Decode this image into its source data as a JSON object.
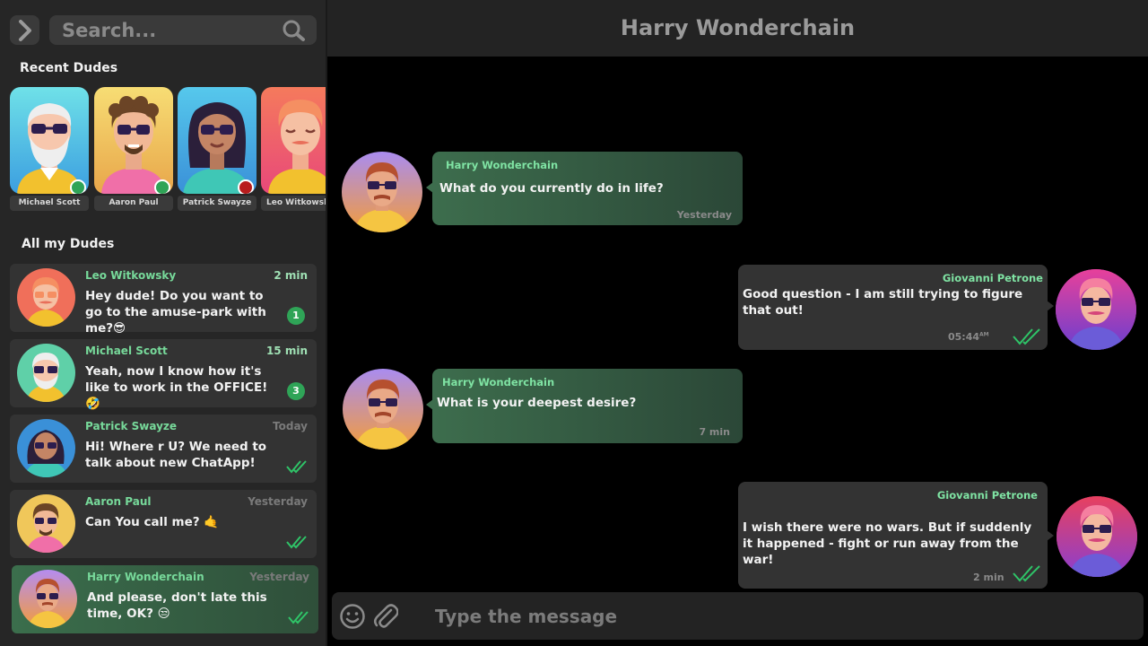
{
  "sidebar": {
    "search_placeholder": "Search...",
    "recent_title": "Recent Dudes",
    "all_title": "All my Dudes",
    "recent": [
      {
        "name": "Michael Scott",
        "status": "online",
        "status_color": "#2fa457",
        "bg": "#5fd0d8"
      },
      {
        "name": "Aaron Paul",
        "status": "online",
        "status_color": "#2fa457",
        "bg": "#f0c75a"
      },
      {
        "name": "Patrick Swayze",
        "status": "busy",
        "status_color": "#b81d1d",
        "bg": "#4bb8e8"
      },
      {
        "name": "Leo Witkowsky",
        "status": "unknown",
        "status_color": "",
        "bg": "#f06f5a"
      }
    ],
    "chats": [
      {
        "name": "Leo Witkowsky",
        "time": "2 min",
        "message": "Hey dude! Do you want to go to the amuse-park with me?😎",
        "badge": "1",
        "indicator": "badge"
      },
      {
        "name": "Michael Scott",
        "time": "15 min",
        "message": "Yeah, now I know how it's like to work in the OFFICE!🤣",
        "badge": "3",
        "indicator": "badge"
      },
      {
        "name": "Patrick Swayze",
        "time": "Today",
        "message": "Hi! Where r U? We need to talk about new ChatApp!",
        "indicator": "double-check-icon"
      },
      {
        "name": "Aaron Paul",
        "time": "Yesterday",
        "message": "Can You call me? 🤙",
        "indicator": "double-check-icon"
      },
      {
        "name": "Harry Wonderchain",
        "time": "Yesterday",
        "message": "And please, don't late this time, OK? 😒",
        "indicator": "double-check-icon",
        "active": true
      }
    ]
  },
  "conversation": {
    "title": "Harry Wonderchain",
    "messages": [
      {
        "from": "Harry Wonderchain",
        "direction": "incoming",
        "text": "What do you currently do in life?",
        "time": "Yesterday"
      },
      {
        "from": "Giovanni Petrone",
        "direction": "outgoing",
        "text": "Good question - I am still trying to figure that out!",
        "time": "05:44",
        "time_suffix": "AM",
        "read": true
      },
      {
        "from": "Harry Wonderchain",
        "direction": "incoming",
        "text": "What is your deepest desire?",
        "time": "7 min"
      },
      {
        "from": "Giovanni Petrone",
        "direction": "outgoing",
        "text": "I wish there were no wars. But if suddenly it happened - fight or run away from the war!",
        "time": "2 min",
        "read": true
      }
    ]
  },
  "composer": {
    "placeholder": "Type the message"
  },
  "colors": {
    "accent_green": "#77d99a",
    "badge_green": "#2fa457",
    "busy_red": "#b81d1d"
  }
}
